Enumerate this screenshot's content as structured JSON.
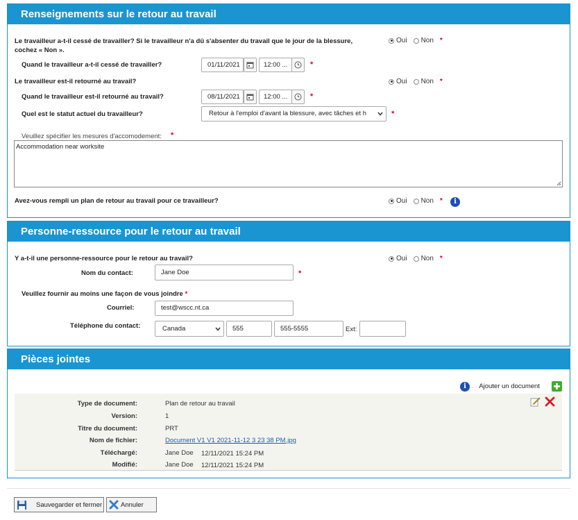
{
  "rtw": {
    "title": "Renseignements sur le retour au travail",
    "q_stopped_line1": "Le travailleur a-t-il cessé de travailler? Si le travailleur n'a dû s'absenter du travail que le jour de la blessure,",
    "q_stopped_line2": "cochez « Non ».",
    "stopped_date_label": "Quand le travailleur a-t-il cessé de travailler?",
    "stopped_date": "01/11/2021",
    "stopped_time": "12:00 ...",
    "q_returned": "Le travailleur est-il retourné au travail?",
    "returned_date_label": "Quand le travailleur est-il retourné au travail?",
    "returned_date": "08/11/2021",
    "returned_time": "12:00 ...",
    "status_label": "Quel est le statut actuel du travailleur?",
    "status_value": "Retour à l'emploi d'avant la blessure, avec tâches et h",
    "accommodation_label": "Veuillez spécifier les mesures d'accomodement:",
    "accommodation_value": "Accommodation near worksite",
    "q_plan": "Avez-vous rempli un plan de retour au travail pour ce travailleur?",
    "oui": "Oui",
    "non": "Non",
    "req": "*"
  },
  "contact": {
    "title": "Personne-ressource pour le retour au travail",
    "q_has_contact": "Y a-t-il une personne-ressource pour le retour au travail?",
    "name_label": "Nom du contact:",
    "name_value": "Jane Doe",
    "reach_label": "Veuillez fournir au moins une façon de vous joindre",
    "email_label": "Courriel:",
    "email_value": "test@wscc.nt.ca",
    "phone_label": "Téléphone du contact:",
    "country": "Canada",
    "area_code": "555",
    "number": "555-5555",
    "ext_label": "Ext:",
    "ext_value": ""
  },
  "attachments": {
    "title": "Pièces jointes",
    "add_document": "Ajouter un document",
    "fields": [
      {
        "label": "Type de document:",
        "value": "Plan de retour au travail"
      },
      {
        "label": "Version:",
        "value": "1"
      },
      {
        "label": "Titre du document:",
        "value": "PRT"
      },
      {
        "label": "Nom de fichier:",
        "value": "Document V1 V1 2021-11-12 3 23 38 PM.jpg"
      },
      {
        "label": "Téléchargé:",
        "value": "Jane Doe",
        "date": "12/11/2021 15:24 PM"
      },
      {
        "label": "Modifié:",
        "value": "Jane Doe",
        "date": "12/11/2021 15:24 PM"
      }
    ]
  },
  "footer": {
    "save_label": "Sauvegarder et fermer",
    "cancel_label": "Annuler"
  },
  "colors": {
    "header_blue": "#1b95d2",
    "required_red": "#e0002a",
    "link_blue": "#1a5ea8"
  }
}
